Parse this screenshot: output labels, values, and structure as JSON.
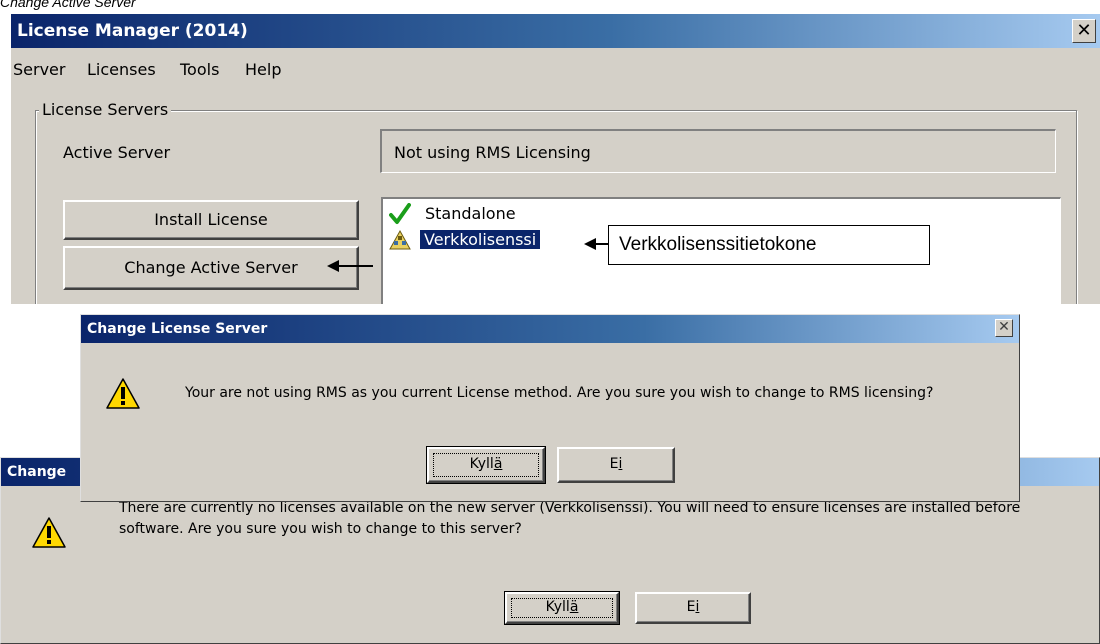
{
  "caption": "Change Active Server",
  "main_window": {
    "title": "License Manager (2014)",
    "close_glyph": "✕",
    "menu": [
      {
        "label": "Server"
      },
      {
        "label": "Licenses"
      },
      {
        "label": "Tools"
      },
      {
        "label": "Help"
      }
    ],
    "group_label": "License Servers",
    "active_server_label": "Active Server",
    "active_server_value": "Not using RMS Licensing",
    "buttons": {
      "install": "Install License",
      "change": "Change Active Server"
    },
    "server_list": [
      {
        "label": "Standalone",
        "icon": "green-check-icon",
        "selected": false
      },
      {
        "label": "Verkkolisenssi",
        "icon": "network-warning-icon",
        "selected": true
      }
    ]
  },
  "annotation": {
    "callout_text": "Verkkolisenssitietokone"
  },
  "dialog1": {
    "title": "Change License Server",
    "message": "Your are not using RMS as you current License method. Are you sure you wish to change to RMS licensing?",
    "yes_prefix": "Kyll",
    "yes_accel": "ä",
    "no_prefix": "E",
    "no_accel": "i",
    "icon": "warning-icon"
  },
  "dialog2": {
    "title": "Change",
    "message_line1": "There are currently no licenses available on the new server (Verkkolisenssi). You will need to ensure licenses are installed before",
    "message_line2": "software. Are you sure you wish to change to this server?",
    "yes_prefix": "Kyll",
    "yes_accel": "ä",
    "no_prefix": "E",
    "no_accel": "i",
    "icon": "warning-icon"
  },
  "colors": {
    "title_dark": "#0a246a",
    "title_light": "#a6caf0",
    "face": "#d4d0c8",
    "selection": "#0a246a"
  }
}
